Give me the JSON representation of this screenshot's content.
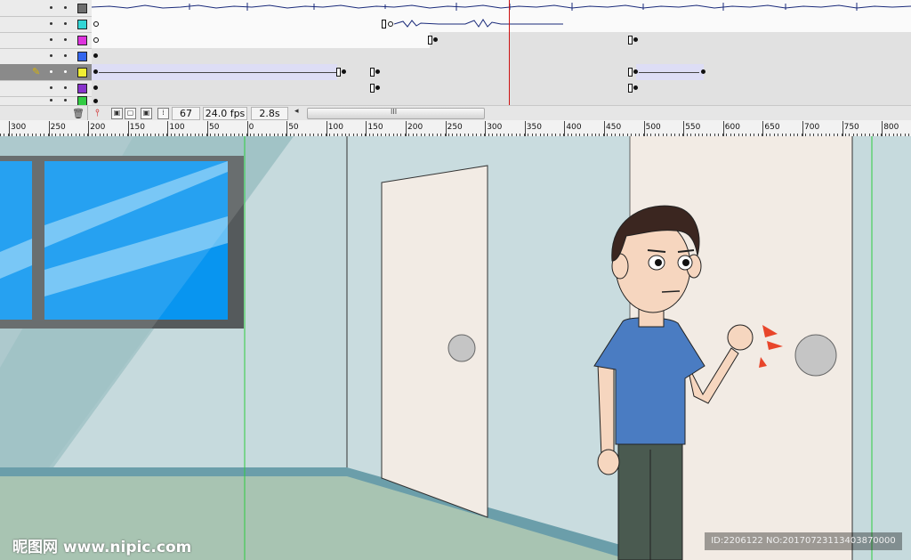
{
  "timeline": {
    "layers": [
      {
        "color": "#6e6e6e",
        "active": false,
        "keys": "audio1"
      },
      {
        "color": "#33d6d6",
        "active": false,
        "keys": "audio2"
      },
      {
        "color": "#dd33dd",
        "active": false,
        "keys": "layer3"
      },
      {
        "color": "#3366ee",
        "active": false,
        "keys": "layer4"
      },
      {
        "color": "#f0ee33",
        "active": true,
        "keys": "layer5"
      },
      {
        "color": "#8833cc",
        "active": false,
        "keys": "layer6"
      },
      {
        "color": "#33cc44",
        "active": false,
        "keys": "layer7"
      }
    ],
    "current_frame": "67",
    "frame_rate": "24.0 fps",
    "elapsed_time": "2.8s",
    "scroll_grip": "III"
  },
  "ruler": {
    "labels": [
      "300",
      "250",
      "200",
      "150",
      "100",
      "50",
      "0",
      "50",
      "100",
      "150",
      "200",
      "250",
      "300",
      "350",
      "400",
      "450",
      "500",
      "550",
      "600",
      "650",
      "700",
      "750",
      "800"
    ]
  },
  "stage": {
    "wall_left_color": "#c6dadd",
    "wall_right_color": "#f2ebe4",
    "floor_color": "#a8c4b2",
    "window_sky_color": "#0895f0"
  },
  "watermark": {
    "site": "昵图网 www.nipic.com",
    "id_text": "ID:2206122 NO:20170723113403870000"
  }
}
